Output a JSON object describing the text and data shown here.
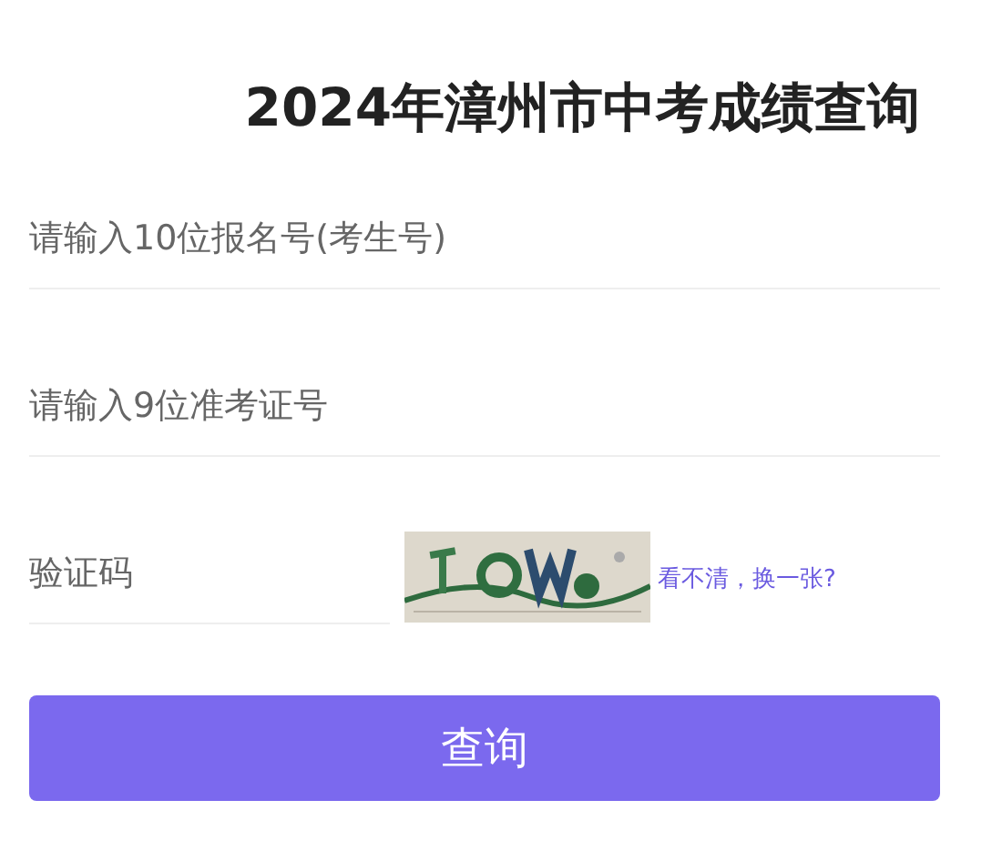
{
  "title": "2024年漳州市中考成绩查询",
  "fields": [
    {
      "placeholder": "请输入10位报名号(考生号)"
    },
    {
      "placeholder": "请输入9位准考证号"
    }
  ],
  "captcha": {
    "placeholder": "验证码",
    "refresh_link": "看不清，换一张?"
  },
  "submit_button": "查询"
}
